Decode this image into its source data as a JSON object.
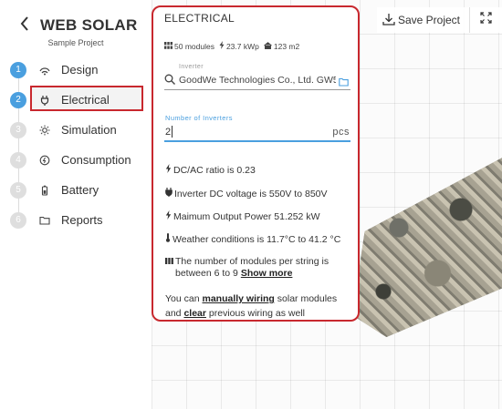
{
  "app": {
    "title": "WEB SOLAR",
    "subtitle": "Sample Project"
  },
  "steps": [
    {
      "num": "1",
      "label": "Design",
      "icon": "design-icon"
    },
    {
      "num": "2",
      "label": "Electrical",
      "icon": "plug-icon"
    },
    {
      "num": "3",
      "label": "Simulation",
      "icon": "sun-icon"
    },
    {
      "num": "4",
      "label": "Consumption",
      "icon": "consumption-icon"
    },
    {
      "num": "5",
      "label": "Battery",
      "icon": "battery-icon"
    },
    {
      "num": "6",
      "label": "Reports",
      "icon": "folder-icon"
    }
  ],
  "toolbar": {
    "save_label": "Save Project"
  },
  "panel": {
    "title": "ELECTRICAL",
    "stats": {
      "modules": "50 modules",
      "power": "23.7 kWp",
      "area": "123 m2"
    },
    "inverter": {
      "label": "Inverter",
      "value": "GoodWe Technologies Co., Ltd. GW5"
    },
    "num_inverters": {
      "label": "Number of Inverters",
      "value": "2",
      "unit": "pcs"
    },
    "info": {
      "dcac": "DC/AC ratio is 0.23",
      "voltage": "Inverter DC voltage is 550V to 850V",
      "max_power": "Maimum Output Power 51.252 kW",
      "weather": "Weather conditions is 11.7°C to 41.2 °C",
      "modules_per_string": "The number of modules per string is between 6 to 9",
      "show_more": "Show more",
      "wiring_prefix": "You can",
      "wiring_link": "manually wiring",
      "wiring_middle": "solar modules and",
      "clear_link": "clear",
      "wiring_suffix": "previous wiring as well"
    }
  },
  "colors": {
    "accent": "#4a9fdf",
    "highlight": "#c8282e",
    "inactive_step": "#dedede"
  }
}
